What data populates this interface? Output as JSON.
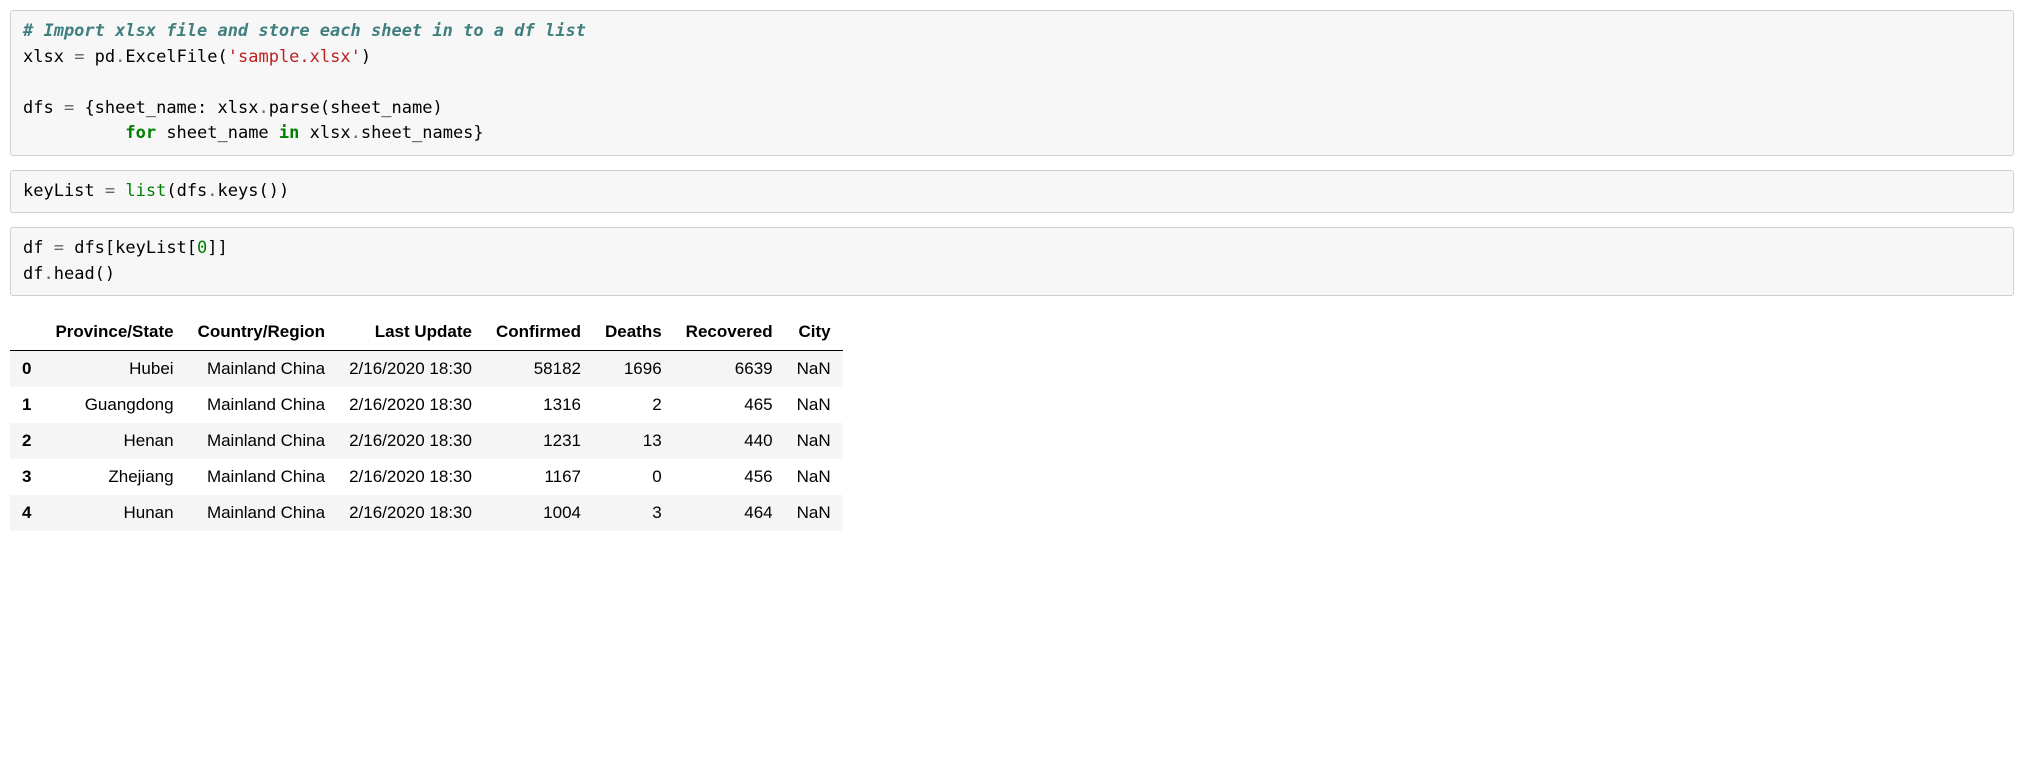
{
  "cell1": {
    "comment": "# Import xlsx file and store each sheet in to a df list",
    "l2a": "xlsx ",
    "l2b": "=",
    "l2c": " pd",
    "l2d": ".",
    "l2e": "ExcelFile(",
    "l2f": "'sample.xlsx'",
    "l2g": ")",
    "l4a": "dfs ",
    "l4b": "=",
    "l4c": " {sheet_name: xlsx",
    "l4d": ".",
    "l4e": "parse(sheet_name)",
    "l5a": "          ",
    "l5b": "for",
    "l5c": " sheet_name ",
    "l5d": "in",
    "l5e": " xlsx",
    "l5f": ".",
    "l5g": "sheet_names}"
  },
  "cell2": {
    "l1a": "keyList ",
    "l1b": "=",
    "l1c": " ",
    "l1d": "list",
    "l1e": "(dfs",
    "l1f": ".",
    "l1g": "keys())"
  },
  "cell3": {
    "l1a": "df ",
    "l1b": "=",
    "l1c": " dfs[keyList[",
    "l1d": "0",
    "l1e": "]]",
    "l2a": "df",
    "l2b": ".",
    "l2c": "head()"
  },
  "table": {
    "headers": [
      "",
      "Province/State",
      "Country/Region",
      "Last Update",
      "Confirmed",
      "Deaths",
      "Recovered",
      "City"
    ],
    "rows": [
      [
        "0",
        "Hubei",
        "Mainland China",
        "2/16/2020 18:30",
        "58182",
        "1696",
        "6639",
        "NaN"
      ],
      [
        "1",
        "Guangdong",
        "Mainland China",
        "2/16/2020 18:30",
        "1316",
        "2",
        "465",
        "NaN"
      ],
      [
        "2",
        "Henan",
        "Mainland China",
        "2/16/2020 18:30",
        "1231",
        "13",
        "440",
        "NaN"
      ],
      [
        "3",
        "Zhejiang",
        "Mainland China",
        "2/16/2020 18:30",
        "1167",
        "0",
        "456",
        "NaN"
      ],
      [
        "4",
        "Hunan",
        "Mainland China",
        "2/16/2020 18:30",
        "1004",
        "3",
        "464",
        "NaN"
      ]
    ]
  }
}
